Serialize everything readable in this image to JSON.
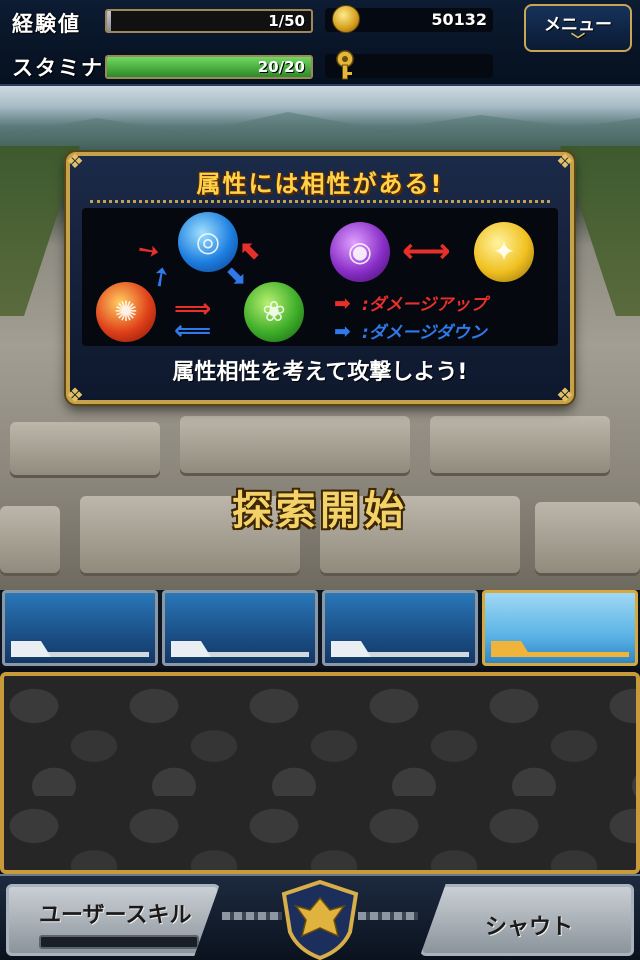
{
  "hud": {
    "exp_label": "経験値",
    "exp_value": "1/50",
    "exp_fraction": 0.02,
    "stamina_label": "スタミナ",
    "stamina_value": "20/20",
    "stamina_fraction": 1.0,
    "gold_value": "50132",
    "menu_label": "メニュー",
    "colors": {
      "exp_bar": "#9aa0a6",
      "stamina_bar": "#3fa53a",
      "frame_gold": "#c7a24c"
    }
  },
  "tutorial": {
    "title": "属性には相性がある!",
    "legend_up": ":ダメージアップ",
    "legend_down": ":ダメージダウン",
    "footer": "属性相性を考えて攻撃しよう!",
    "orbs": [
      {
        "name": "water-orb",
        "color": "#1e7fe0"
      },
      {
        "name": "fire-orb",
        "color": "#e0401a"
      },
      {
        "name": "wood-orb",
        "color": "#3fae2a"
      },
      {
        "name": "dark-orb",
        "color": "#8a2fc8"
      },
      {
        "name": "light-orb",
        "color": "#f0c020"
      }
    ],
    "colors": {
      "up_arrow": "#e8302a",
      "down_arrow": "#2f7ae8"
    }
  },
  "scene": {
    "start_text": "探索開始"
  },
  "party": {
    "slots": [
      {
        "active": false
      },
      {
        "active": false
      },
      {
        "active": false
      },
      {
        "active": true
      }
    ]
  },
  "bottom": {
    "skill_label": "ユーザースキル",
    "shout_label": "シャウト",
    "emblem_icon": "phoenix-shield-icon"
  }
}
